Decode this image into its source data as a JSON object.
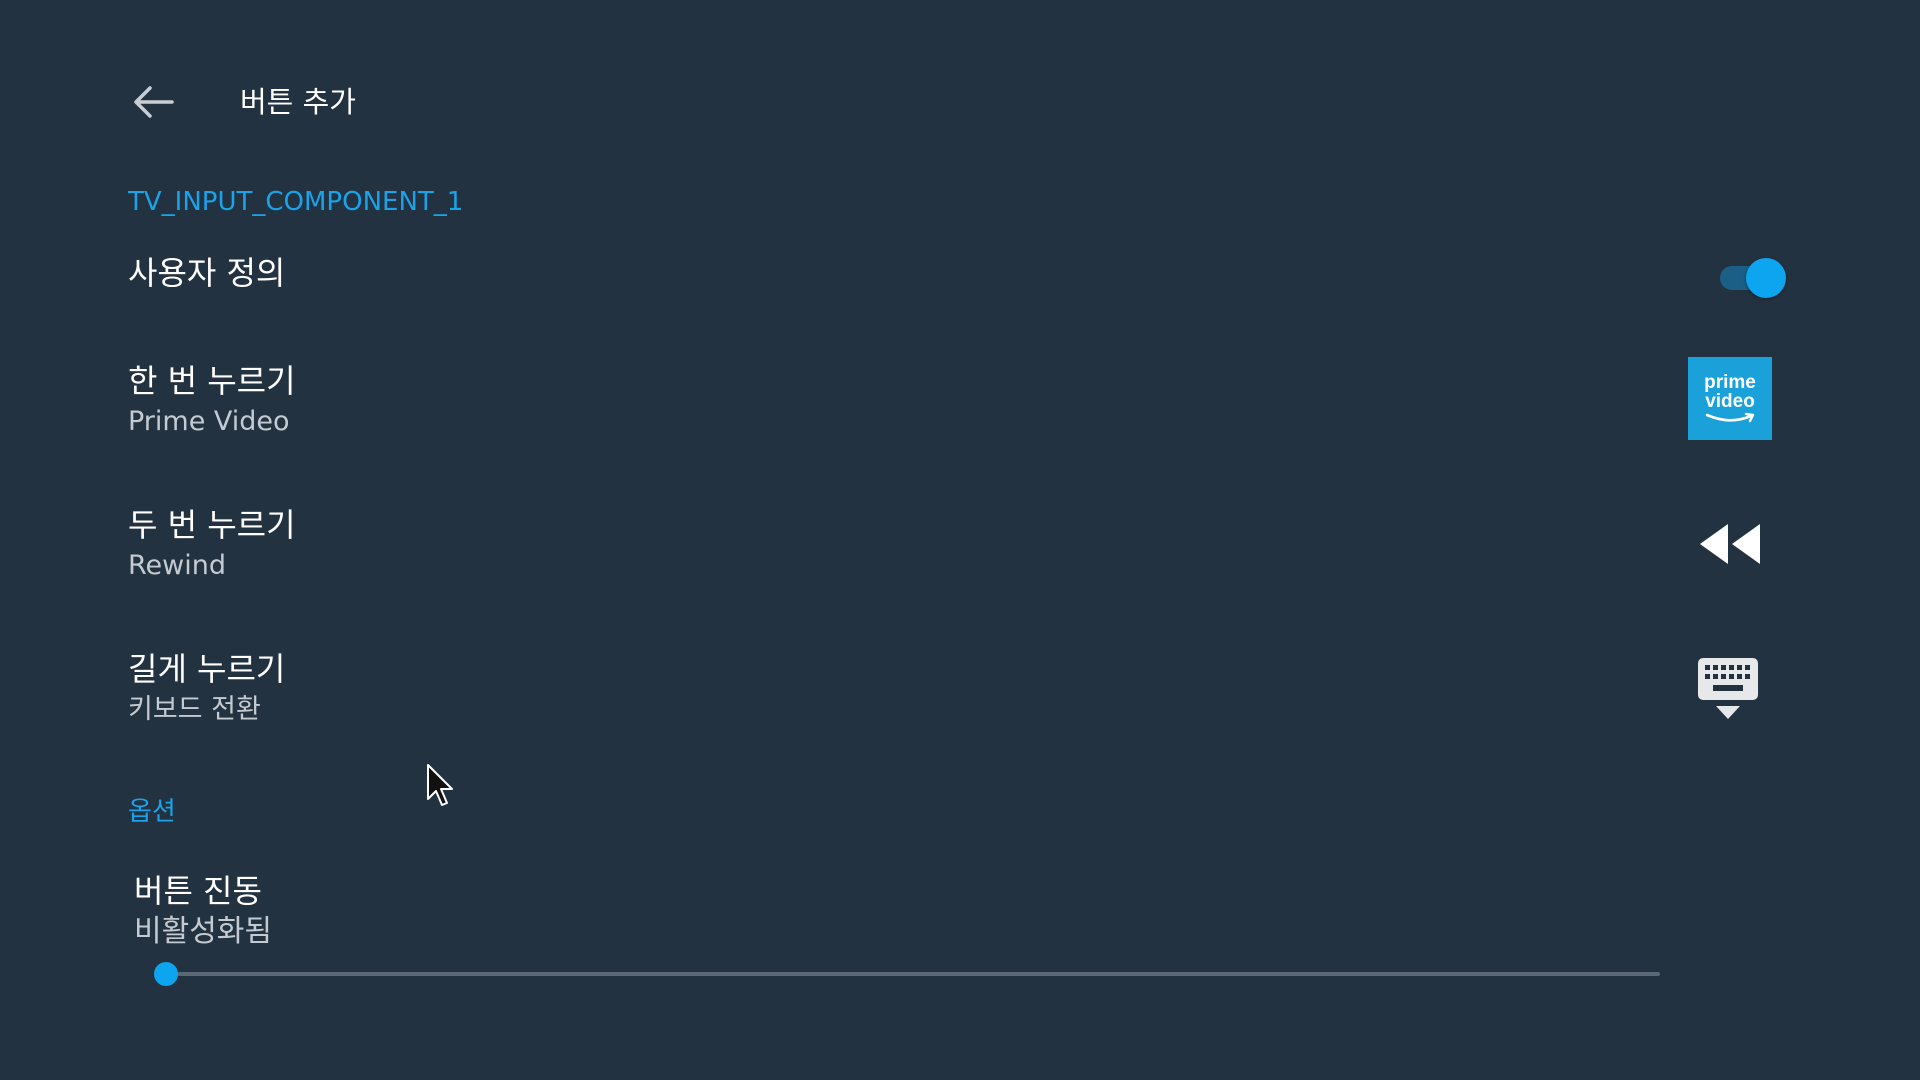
{
  "header": {
    "title": "버튼 추가",
    "back_icon": "arrow-left-icon"
  },
  "section_button": {
    "header": "TV_INPUT_COMPONENT_1",
    "custom": {
      "title": "사용자 정의",
      "toggle_on": true
    },
    "single_press": {
      "title": "한 번 누르기",
      "subtitle": "Prime Video",
      "icon": "prime-video-logo",
      "logo_line1": "prime",
      "logo_line2": "video"
    },
    "double_press": {
      "title": "두 번 누르기",
      "subtitle": "Rewind",
      "icon": "rewind-icon"
    },
    "long_press": {
      "title": "길게 누르기",
      "subtitle": "키보드 전환",
      "icon": "keyboard-hide-icon"
    }
  },
  "section_options": {
    "header": "옵션",
    "vibration": {
      "title": "버튼 진동",
      "subtitle": "비활성화됨",
      "level": 0
    }
  },
  "colors": {
    "background": "#233241",
    "accent": "#0ea5f0",
    "section_header": "#1aa3e8",
    "prime_blue": "#1aa1da"
  }
}
